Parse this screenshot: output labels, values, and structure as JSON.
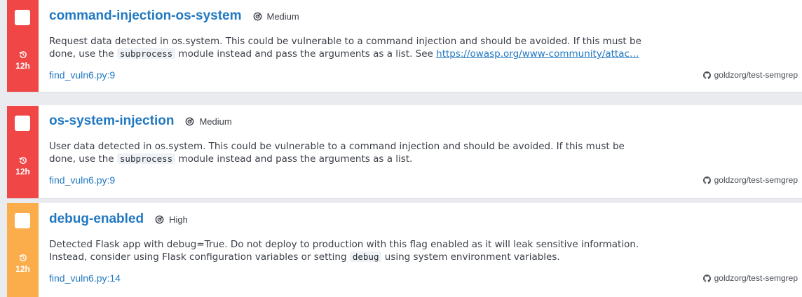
{
  "findings": [
    {
      "accent_color": "#f04646",
      "age": "12h",
      "rule": "command-injection-os-system",
      "severity": "Medium",
      "message_before_code": "Request data detected in os.system. This could be vulnerable to a command injection and should be avoided. If this must be done, use the ",
      "code": "subprocess",
      "message_after_code": " module instead and pass the arguments as a list. See ",
      "link_text": "https://owasp.org/www-community/attac…",
      "location": "find_vuln6.py:9",
      "repo": "goldzorg/test-semgrep"
    },
    {
      "accent_color": "#f04646",
      "age": "12h",
      "rule": "os-system-injection",
      "severity": "Medium",
      "message_before_code": "User data detected in os.system. This could be vulnerable to a command injection and should be avoided. If this must be done, use the ",
      "code": "subprocess",
      "message_after_code": " module instead and pass the arguments as a list.",
      "location": "find_vuln6.py:9",
      "repo": "goldzorg/test-semgrep"
    },
    {
      "accent_color": "#fbad4c",
      "age": "12h",
      "rule": "debug-enabled",
      "severity": "High",
      "message_before_code": "Detected Flask app with debug=True. Do not deploy to production with this flag enabled as it will leak sensitive information. Instead, consider using Flask configuration variables or setting ",
      "code": "debug",
      "message_after_code": " using system environment variables.",
      "location": "find_vuln6.py:14",
      "repo": "goldzorg/test-semgrep"
    }
  ]
}
